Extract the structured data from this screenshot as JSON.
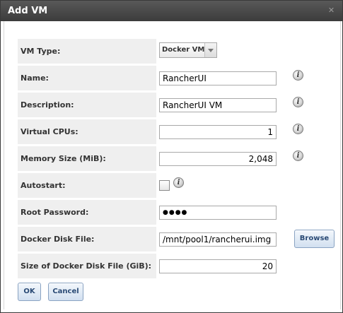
{
  "dialog": {
    "title": "Add VM"
  },
  "form": {
    "vm_type": {
      "label": "VM Type:",
      "value": "Docker VM"
    },
    "name": {
      "label": "Name:",
      "value": "RancherUI"
    },
    "description": {
      "label": "Description:",
      "value": "RancherUI VM"
    },
    "virtual_cpus": {
      "label": "Virtual CPUs:",
      "value": "1"
    },
    "memory_size": {
      "label": "Memory Size (MiB):",
      "value": "2,048"
    },
    "autostart": {
      "label": "Autostart:",
      "checked": false
    },
    "root_password": {
      "label": "Root Password:",
      "value": "●●●●"
    },
    "docker_disk_file": {
      "label": "Docker Disk File:",
      "value": "/mnt/pool1/rancherui.img",
      "browse_label": "Browse"
    },
    "docker_disk_size": {
      "label": "Size of Docker Disk File (GiB):",
      "value": "20"
    }
  },
  "buttons": {
    "ok": "OK",
    "cancel": "Cancel"
  },
  "icons": {
    "close": "close-icon",
    "info": "info-icon",
    "dropdown": "chevron-down-icon"
  },
  "colors": {
    "titlebar": "#474747",
    "label_bg": "#efefef",
    "button_text": "#2a4a75"
  }
}
